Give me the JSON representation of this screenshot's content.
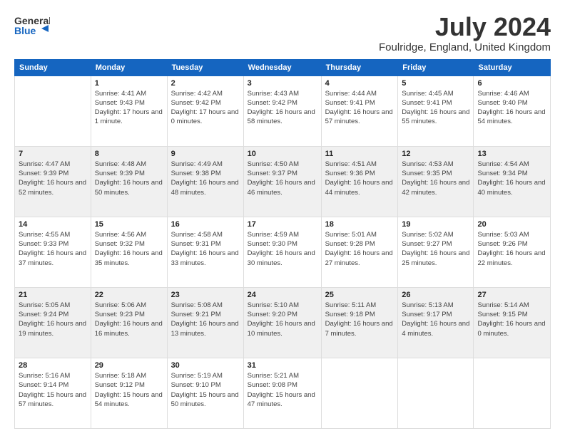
{
  "logo": {
    "line1": "General",
    "line2": "Blue",
    "icon": "▶"
  },
  "title": "July 2024",
  "subtitle": "Foulridge, England, United Kingdom",
  "days_of_week": [
    "Sunday",
    "Monday",
    "Tuesday",
    "Wednesday",
    "Thursday",
    "Friday",
    "Saturday"
  ],
  "weeks": [
    [
      {
        "day": "",
        "info": ""
      },
      {
        "day": "1",
        "info": "Sunrise: 4:41 AM\nSunset: 9:43 PM\nDaylight: 17 hours\nand 1 minute."
      },
      {
        "day": "2",
        "info": "Sunrise: 4:42 AM\nSunset: 9:42 PM\nDaylight: 17 hours\nand 0 minutes."
      },
      {
        "day": "3",
        "info": "Sunrise: 4:43 AM\nSunset: 9:42 PM\nDaylight: 16 hours\nand 58 minutes."
      },
      {
        "day": "4",
        "info": "Sunrise: 4:44 AM\nSunset: 9:41 PM\nDaylight: 16 hours\nand 57 minutes."
      },
      {
        "day": "5",
        "info": "Sunrise: 4:45 AM\nSunset: 9:41 PM\nDaylight: 16 hours\nand 55 minutes."
      },
      {
        "day": "6",
        "info": "Sunrise: 4:46 AM\nSunset: 9:40 PM\nDaylight: 16 hours\nand 54 minutes."
      }
    ],
    [
      {
        "day": "7",
        "info": "Sunrise: 4:47 AM\nSunset: 9:39 PM\nDaylight: 16 hours\nand 52 minutes."
      },
      {
        "day": "8",
        "info": "Sunrise: 4:48 AM\nSunset: 9:39 PM\nDaylight: 16 hours\nand 50 minutes."
      },
      {
        "day": "9",
        "info": "Sunrise: 4:49 AM\nSunset: 9:38 PM\nDaylight: 16 hours\nand 48 minutes."
      },
      {
        "day": "10",
        "info": "Sunrise: 4:50 AM\nSunset: 9:37 PM\nDaylight: 16 hours\nand 46 minutes."
      },
      {
        "day": "11",
        "info": "Sunrise: 4:51 AM\nSunset: 9:36 PM\nDaylight: 16 hours\nand 44 minutes."
      },
      {
        "day": "12",
        "info": "Sunrise: 4:53 AM\nSunset: 9:35 PM\nDaylight: 16 hours\nand 42 minutes."
      },
      {
        "day": "13",
        "info": "Sunrise: 4:54 AM\nSunset: 9:34 PM\nDaylight: 16 hours\nand 40 minutes."
      }
    ],
    [
      {
        "day": "14",
        "info": "Sunrise: 4:55 AM\nSunset: 9:33 PM\nDaylight: 16 hours\nand 37 minutes."
      },
      {
        "day": "15",
        "info": "Sunrise: 4:56 AM\nSunset: 9:32 PM\nDaylight: 16 hours\nand 35 minutes."
      },
      {
        "day": "16",
        "info": "Sunrise: 4:58 AM\nSunset: 9:31 PM\nDaylight: 16 hours\nand 33 minutes."
      },
      {
        "day": "17",
        "info": "Sunrise: 4:59 AM\nSunset: 9:30 PM\nDaylight: 16 hours\nand 30 minutes."
      },
      {
        "day": "18",
        "info": "Sunrise: 5:01 AM\nSunset: 9:28 PM\nDaylight: 16 hours\nand 27 minutes."
      },
      {
        "day": "19",
        "info": "Sunrise: 5:02 AM\nSunset: 9:27 PM\nDaylight: 16 hours\nand 25 minutes."
      },
      {
        "day": "20",
        "info": "Sunrise: 5:03 AM\nSunset: 9:26 PM\nDaylight: 16 hours\nand 22 minutes."
      }
    ],
    [
      {
        "day": "21",
        "info": "Sunrise: 5:05 AM\nSunset: 9:24 PM\nDaylight: 16 hours\nand 19 minutes."
      },
      {
        "day": "22",
        "info": "Sunrise: 5:06 AM\nSunset: 9:23 PM\nDaylight: 16 hours\nand 16 minutes."
      },
      {
        "day": "23",
        "info": "Sunrise: 5:08 AM\nSunset: 9:21 PM\nDaylight: 16 hours\nand 13 minutes."
      },
      {
        "day": "24",
        "info": "Sunrise: 5:10 AM\nSunset: 9:20 PM\nDaylight: 16 hours\nand 10 minutes."
      },
      {
        "day": "25",
        "info": "Sunrise: 5:11 AM\nSunset: 9:18 PM\nDaylight: 16 hours\nand 7 minutes."
      },
      {
        "day": "26",
        "info": "Sunrise: 5:13 AM\nSunset: 9:17 PM\nDaylight: 16 hours\nand 4 minutes."
      },
      {
        "day": "27",
        "info": "Sunrise: 5:14 AM\nSunset: 9:15 PM\nDaylight: 16 hours\nand 0 minutes."
      }
    ],
    [
      {
        "day": "28",
        "info": "Sunrise: 5:16 AM\nSunset: 9:14 PM\nDaylight: 15 hours\nand 57 minutes."
      },
      {
        "day": "29",
        "info": "Sunrise: 5:18 AM\nSunset: 9:12 PM\nDaylight: 15 hours\nand 54 minutes."
      },
      {
        "day": "30",
        "info": "Sunrise: 5:19 AM\nSunset: 9:10 PM\nDaylight: 15 hours\nand 50 minutes."
      },
      {
        "day": "31",
        "info": "Sunrise: 5:21 AM\nSunset: 9:08 PM\nDaylight: 15 hours\nand 47 minutes."
      },
      {
        "day": "",
        "info": ""
      },
      {
        "day": "",
        "info": ""
      },
      {
        "day": "",
        "info": ""
      }
    ]
  ]
}
